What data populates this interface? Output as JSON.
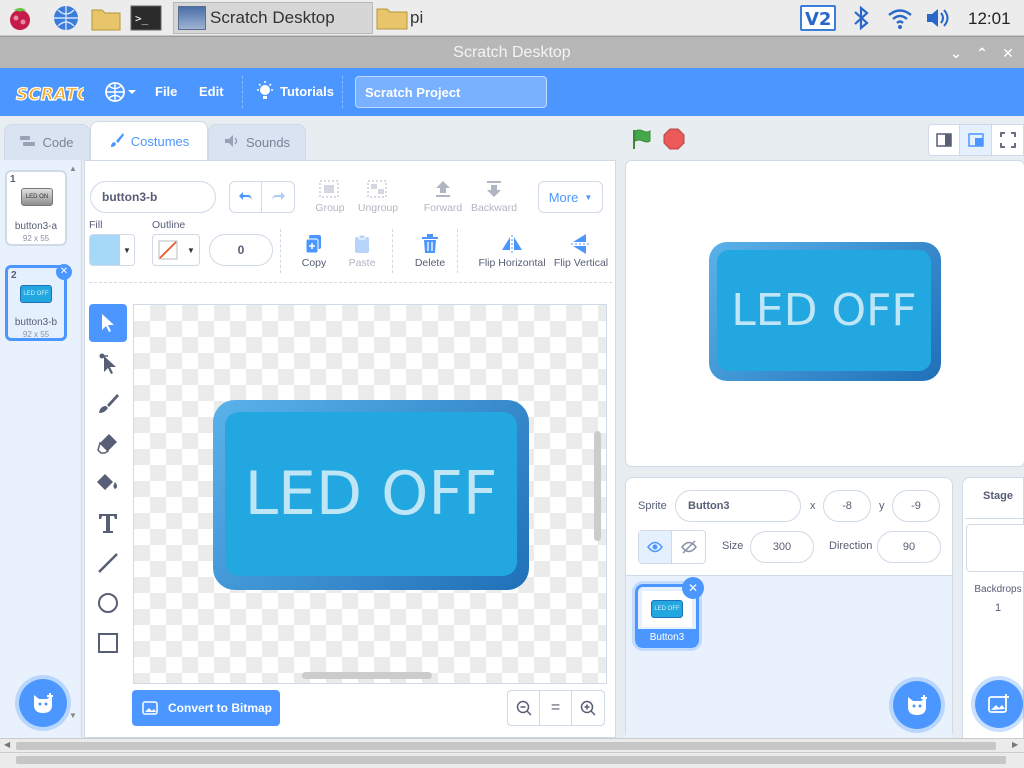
{
  "taskbar": {
    "tasks": [
      {
        "label": "Scratch Desktop",
        "active": true
      },
      {
        "label": "pi",
        "active": false
      }
    ],
    "clock": "12:01"
  },
  "window": {
    "title": "Scratch Desktop"
  },
  "menubar": {
    "logo": "SCRATCH",
    "file": "File",
    "edit": "Edit",
    "tutorials": "Tutorials",
    "project_title": "Scratch Project"
  },
  "tabs": {
    "code": "Code",
    "costumes": "Costumes",
    "sounds": "Sounds"
  },
  "costumes": [
    {
      "number": "1",
      "name": "button3-a",
      "size": "92 x 55",
      "thumb": "LED ON",
      "selected": false
    },
    {
      "number": "2",
      "name": "button3-b",
      "size": "92 x 55",
      "thumb": "LED OFF",
      "selected": true
    }
  ],
  "editor": {
    "costume_name": "button3-b",
    "group": "Group",
    "ungroup": "Ungroup",
    "forward": "Forward",
    "backward": "Backward",
    "more": "More",
    "fill_label": "Fill",
    "outline_label": "Outline",
    "outline_width": "0",
    "copy": "Copy",
    "paste": "Paste",
    "delete": "Delete",
    "flip_h": "Flip Horizontal",
    "flip_v": "Flip Vertical",
    "canvas_text": "LED OFF",
    "convert": "Convert to Bitmap",
    "zoom_reset": "="
  },
  "stage": {
    "text": "LED OFF"
  },
  "sprite": {
    "label": "Sprite",
    "name": "Button3",
    "x_label": "x",
    "x": "-8",
    "y_label": "y",
    "y": "-9",
    "size_label": "Size",
    "size": "300",
    "direction_label": "Direction",
    "direction": "90",
    "list": [
      {
        "name": "Button3",
        "thumb": "LED OFF"
      }
    ]
  },
  "stage_pane": {
    "title": "Stage",
    "backdrops_label": "Backdrops",
    "backdrops_count": "1"
  },
  "colors": {
    "accent": "#4c97ff",
    "fill_swatch": "#a6d9f7",
    "led_face": "#22a7e0",
    "led_text": "#bfe6f7",
    "green_flag": "#45a94b",
    "stop": "#ec5959"
  }
}
